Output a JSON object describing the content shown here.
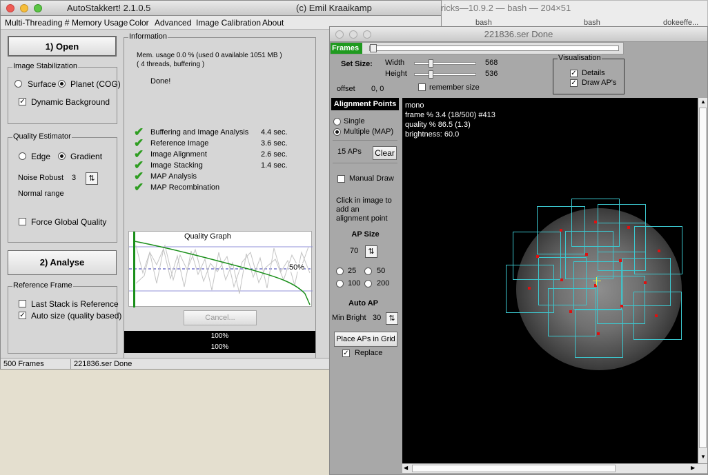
{
  "terminal": {
    "title": "ricks—10.9.2 — bash — 204×51",
    "tabs": [
      "bash",
      "bash",
      "dokeeffe..."
    ]
  },
  "main_window": {
    "title": "AutoStakkert! 2.1.0.5",
    "copyright": "(c) Emil Kraaikamp",
    "menu": [
      "Multi-Threading #",
      "Memory Usage",
      "Color",
      "Advanced",
      "Image Calibration",
      "About"
    ],
    "open_button": "1) Open",
    "image_stabilization": {
      "label": "Image Stabilization",
      "surface": "Surface",
      "planet": "Planet (COG)",
      "dynamic_background": "Dynamic Background"
    },
    "quality_estimator": {
      "label": "Quality Estimator",
      "edge": "Edge",
      "gradient": "Gradient",
      "noise_robust_label": "Noise Robust",
      "noise_robust_value": "3",
      "normal_range": "Normal range",
      "force_global": "Force Global Quality"
    },
    "analyse_button": "2) Analyse",
    "reference_frame": {
      "label": "Reference Frame",
      "last_stack": "Last Stack is Reference",
      "auto_size": "Auto size (quality based)"
    },
    "information": {
      "label": "Information",
      "mem_line1": "Mem. usage 0.0 %  (used 0 available 1051 MB )",
      "mem_line2": "( 4 threads, buffering )",
      "done": "Done!",
      "steps": [
        {
          "name": "Buffering and Image Analysis",
          "time": "4.4 sec."
        },
        {
          "name": "Reference Image",
          "time": "3.6 sec."
        },
        {
          "name": "Image Alignment",
          "time": "2.6 sec."
        },
        {
          "name": "Image Stacking",
          "time": "1.4 sec."
        },
        {
          "name": "MAP Analysis",
          "time": ""
        },
        {
          "name": "MAP Recombination",
          "time": ""
        }
      ]
    },
    "quality_graph": {
      "title": "Quality Graph",
      "marker": "50%"
    },
    "cancel_button": "Cancel...",
    "progress1": "100%",
    "progress2": "100%",
    "status_frames": "500 Frames",
    "status_file": "221836.ser  Done"
  },
  "viewer": {
    "title": "221836.ser   Done",
    "frames_label": "Frames",
    "set_size_label": "Set Size:",
    "width_label": "Width",
    "width_value": "568",
    "height_label": "Height",
    "height_value": "536",
    "offset_label": "offset",
    "offset_value": "0, 0",
    "remember_size": "remember size",
    "visualisation_label": "Visualisation",
    "details": "Details",
    "draw_aps": "Draw AP's",
    "alignment_points_header": "Alignment Points",
    "single": "Single",
    "multiple": "Multiple (MAP)",
    "ap_count": "15 APs",
    "clear_button": "Clear",
    "manual_draw": "Manual Draw",
    "click_hint": "Click in image to add an alignment point",
    "ap_size_header": "AP Size",
    "ap_size_value": "70",
    "size_options": [
      "25",
      "50",
      "100",
      "200"
    ],
    "auto_ap_header": "Auto AP",
    "min_bright_label": "Min Bright",
    "min_bright_value": "30",
    "place_button": "Place APs in Grid",
    "replace": "Replace",
    "overlay": {
      "line1": "mono",
      "line2": "frame % 3.4 (18/500) #413",
      "line3": "quality % 86.5  (1.3)",
      "line4": "brightness: 60.0"
    }
  },
  "colors": {
    "check_green": "#2e9d21",
    "graph_green": "#1a8f1a",
    "ap_box": "#3cc8d0",
    "ap_dot": "#e01010"
  }
}
